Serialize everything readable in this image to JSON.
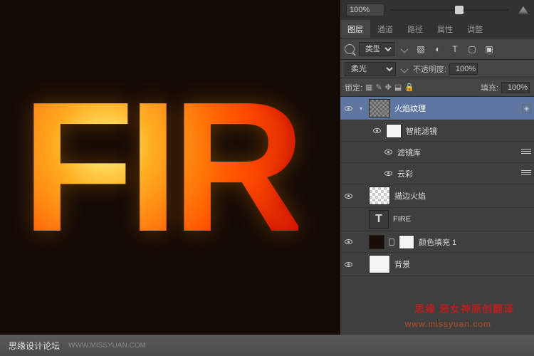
{
  "zoom": {
    "value": "100%"
  },
  "tabs": {
    "layers": "图层",
    "channels": "通道",
    "paths": "路径",
    "properties": "属性",
    "adjustments": "调整"
  },
  "filter": {
    "kind": "类型"
  },
  "blend": {
    "mode": "柔光",
    "opacity_label": "不透明度:",
    "opacity_value": "100%"
  },
  "lock": {
    "label": "锁定:",
    "fill_label": "填充:",
    "fill_value": "100%"
  },
  "layers": {
    "flame_texture": "火焰纹理",
    "smart_filters": "智能滤镜",
    "filter_gallery": "滤镜库",
    "clouds": "云彩",
    "stroke_flame": "描边火焰",
    "fire_text": "FIRE",
    "color_fill": "颜色填充 1",
    "background": "背景"
  },
  "watermark": {
    "line1": "思缘   恶女神原创翻译",
    "line2": "www.missyuan.com"
  },
  "footer": {
    "brand": "思缘设计论坛",
    "url": "WWW.MISSYUAN.COM"
  }
}
